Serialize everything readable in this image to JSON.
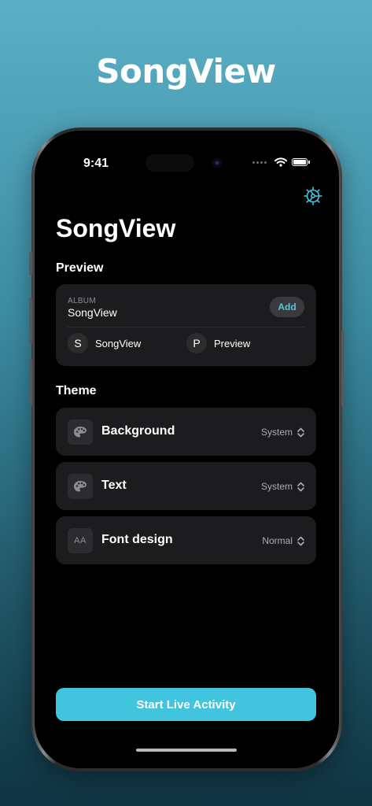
{
  "promo": {
    "title": "SongView"
  },
  "status_bar": {
    "time": "9:41"
  },
  "app": {
    "title": "SongView",
    "accent_color": "#41c5de"
  },
  "preview": {
    "section_title": "Preview",
    "album_label": "ALBUM",
    "album_title": "SongView",
    "add_label": "Add",
    "artists": [
      {
        "initial": "S",
        "name": "SongView"
      },
      {
        "initial": "P",
        "name": "Preview"
      }
    ]
  },
  "theme": {
    "section_title": "Theme",
    "rows": [
      {
        "icon": "palette-icon",
        "label": "Background",
        "value": "System"
      },
      {
        "icon": "palette-icon",
        "label": "Text",
        "value": "System"
      },
      {
        "icon": "font-size-icon",
        "icon_text": "AA",
        "label": "Font design",
        "value": "Normal"
      }
    ]
  },
  "cta": {
    "label": "Start Live Activity"
  }
}
